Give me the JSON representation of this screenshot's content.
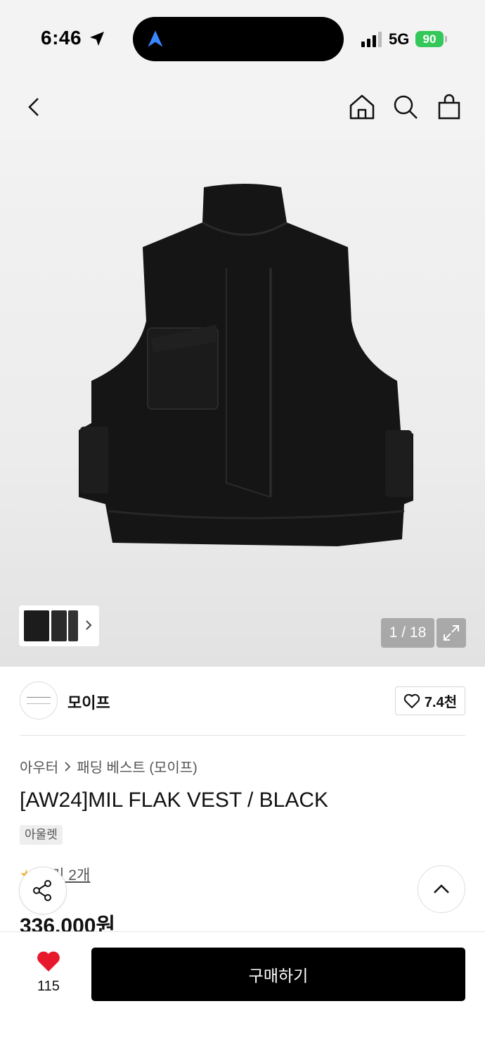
{
  "status_bar": {
    "time": "6:46",
    "network": "5G",
    "battery": "90"
  },
  "header": {
    "back_icon": "chevron-left-icon",
    "home_icon": "home-icon",
    "search_icon": "search-icon",
    "cart_icon": "shopping-bag-icon"
  },
  "gallery": {
    "counter": "1 / 18",
    "expand_icon": "expand-icon"
  },
  "brand": {
    "name": "모이프",
    "likes": "7.4천"
  },
  "product": {
    "breadcrumb": [
      "아우터",
      "패딩 베스트 (모이프)"
    ],
    "title": "[AW24]MIL FLAK VEST / BLACK",
    "tag": "아울렛",
    "review": "후기 2개",
    "price": "336,000원"
  },
  "bottom_bar": {
    "heart_count": "115",
    "buy_label": "구매하기"
  },
  "colors": {
    "accent": "#000000",
    "heart": "#e8192c",
    "battery": "#34c759",
    "star": "#f5a623"
  }
}
